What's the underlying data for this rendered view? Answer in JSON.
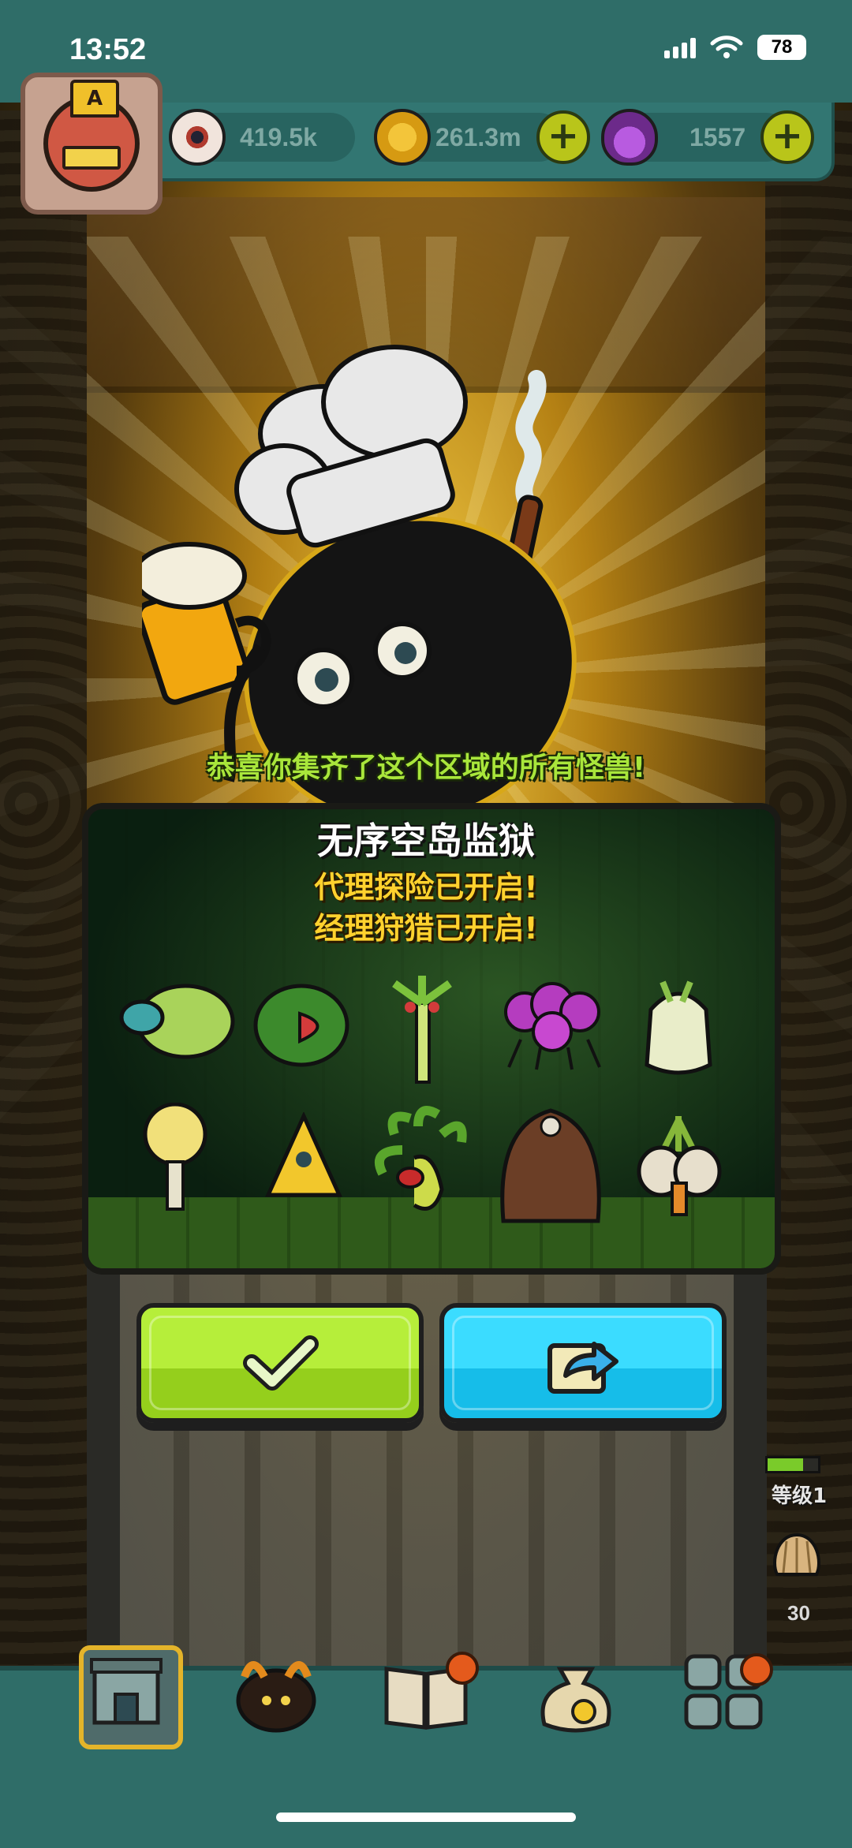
{
  "status_bar": {
    "time": "13:52",
    "battery": "78"
  },
  "resources": {
    "eyes": "419.5k",
    "coins": "261.3m",
    "potions": "1557"
  },
  "avatar": {
    "badge_letter": "A"
  },
  "popup": {
    "congrats": "恭喜你集齐了这个区域的所有怪兽!",
    "region_name": "无序空岛监狱",
    "unlock_lines": [
      "代理探险已开启!",
      "经理狩猎已开启!"
    ],
    "monsters": [
      "lettuce-turtle-monster",
      "watermelon-fish-monster",
      "palm-sprout-monster",
      "grape-spider-monster",
      "radish-ghost-monster",
      "cauliflower-monster",
      "cheese-wedge-monster",
      "medusa-plant-monster",
      "hairy-bigfoot-monster",
      "onion-bulb-monster"
    ]
  },
  "buttons": {
    "confirm_icon": "checkmark-icon",
    "share_icon": "share-icon"
  },
  "side_widget": {
    "level_label": "等级1",
    "shell_count": "30"
  },
  "bottom_nav": [
    "tavern",
    "monster-pit",
    "monster-book",
    "money-bag",
    "grid-menu"
  ],
  "colors": {
    "teal_header": "#2f6d68",
    "green_button": "#a6e52f",
    "blue_button": "#1fc8f2",
    "congrats_text": "#a9e63b",
    "unlock_text": "#ffd22e"
  }
}
